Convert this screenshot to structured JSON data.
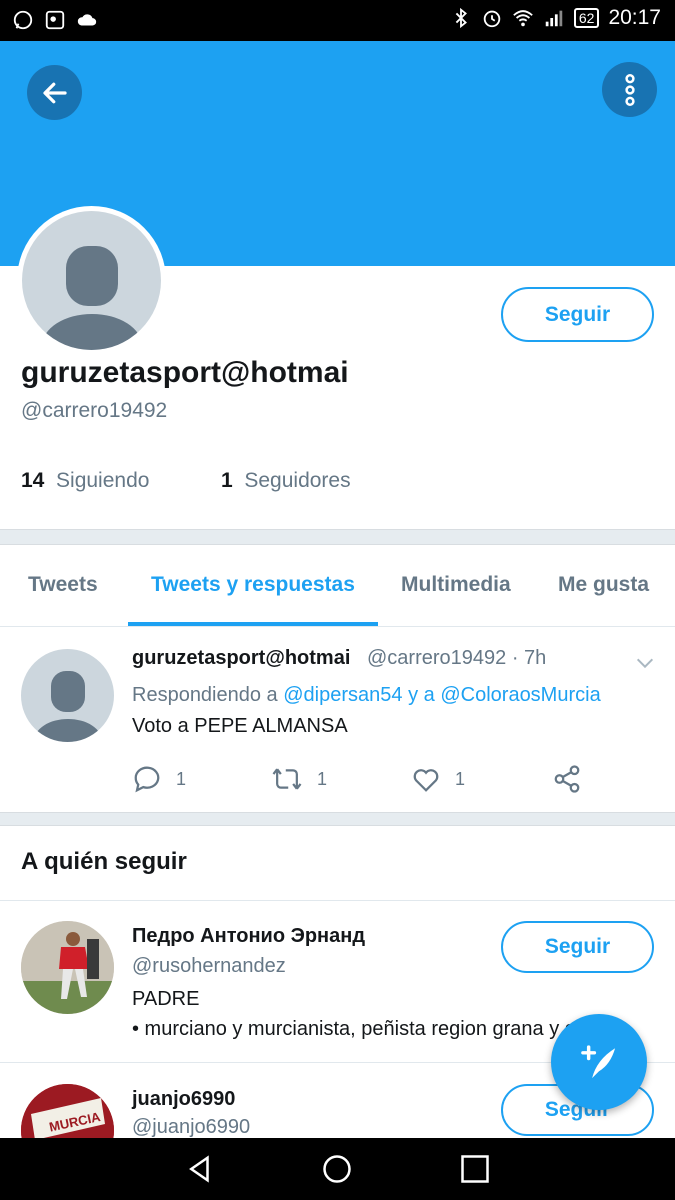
{
  "status_bar": {
    "time": "20:17",
    "battery": "62"
  },
  "profile": {
    "name": "guruzetasport@hotmai",
    "handle": "@carrero19492",
    "follow_label": "Seguir",
    "following_count": "14",
    "following_label": "Siguiendo",
    "followers_count": "1",
    "followers_label": "Seguidores"
  },
  "tabs": [
    "Tweets",
    "Tweets y respuestas",
    "Multimedia",
    "Me gusta"
  ],
  "tweet": {
    "name": "guruzetasport@hotmai",
    "meta": "@carrero19492 · 7h",
    "reply_prefix": "Respondiendo a",
    "reply_user1": "@dipersan54",
    "reply_mid": "y a",
    "reply_user2": "@ColoraosMurcia",
    "text": "Voto a PEPE ALMANSA",
    "reply_count": "1",
    "retweet_count": "1",
    "like_count": "1"
  },
  "who_to_follow": {
    "title": "A quién seguir",
    "follow_label": "Seguir",
    "users": [
      {
        "name": "Педро Антонио Эрнанд",
        "handle": "@rusohernandez",
        "bio_line1": "PADRE",
        "bio_line2": "• murciano y murcianista, peñista region grana y grana"
      },
      {
        "name": "juanjo6990",
        "handle": "@juanjo6990"
      }
    ]
  },
  "colors": {
    "accent": "#1da1f2",
    "secondary_text": "#657786"
  }
}
